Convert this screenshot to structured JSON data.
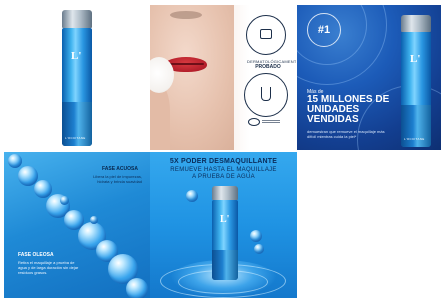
{
  "tiles": {
    "product": {
      "bottle_mark": "L'",
      "brand": "L'OCCITANE"
    },
    "claims": {
      "badge_line1": "DERMATOLÓGICAMENTE",
      "badge_line2": "PROBADO"
    },
    "sales": {
      "seal": "#1",
      "pre": "Más de",
      "headline": "15 MILLONES DE UNIDADES VENDIDAS",
      "sub": "demuestran que remueve el maquillaje más difícil mientras cuida la piel*",
      "bottle_mark": "L'",
      "brand": "L'OCCITANE"
    },
    "phases": {
      "phase1_title": "FASE ACUOSA",
      "phase1_text": "Libera la piel de impurezas, hidrata y brinda suavidad",
      "phase2_title": "FASE OLEOSA",
      "phase2_text": "Retira el maquillaje a prueba de agua y de larga duración sin dejar residuos grasos."
    },
    "power": {
      "headline": "5X PODER DESMAQUILLANTE",
      "sub": "REMUEVE HASTA EL MAQUILLAJE A PRUEBA DE AGUA",
      "bottle_mark": "L'"
    }
  },
  "colors": {
    "navy": "#0a2c5a",
    "ocean": "#133f91",
    "sky": "#2a97e2",
    "lip_red": "#b31e2a"
  },
  "icons": [
    "certified-badge-icon",
    "flask-icon",
    "eye-icon"
  ]
}
